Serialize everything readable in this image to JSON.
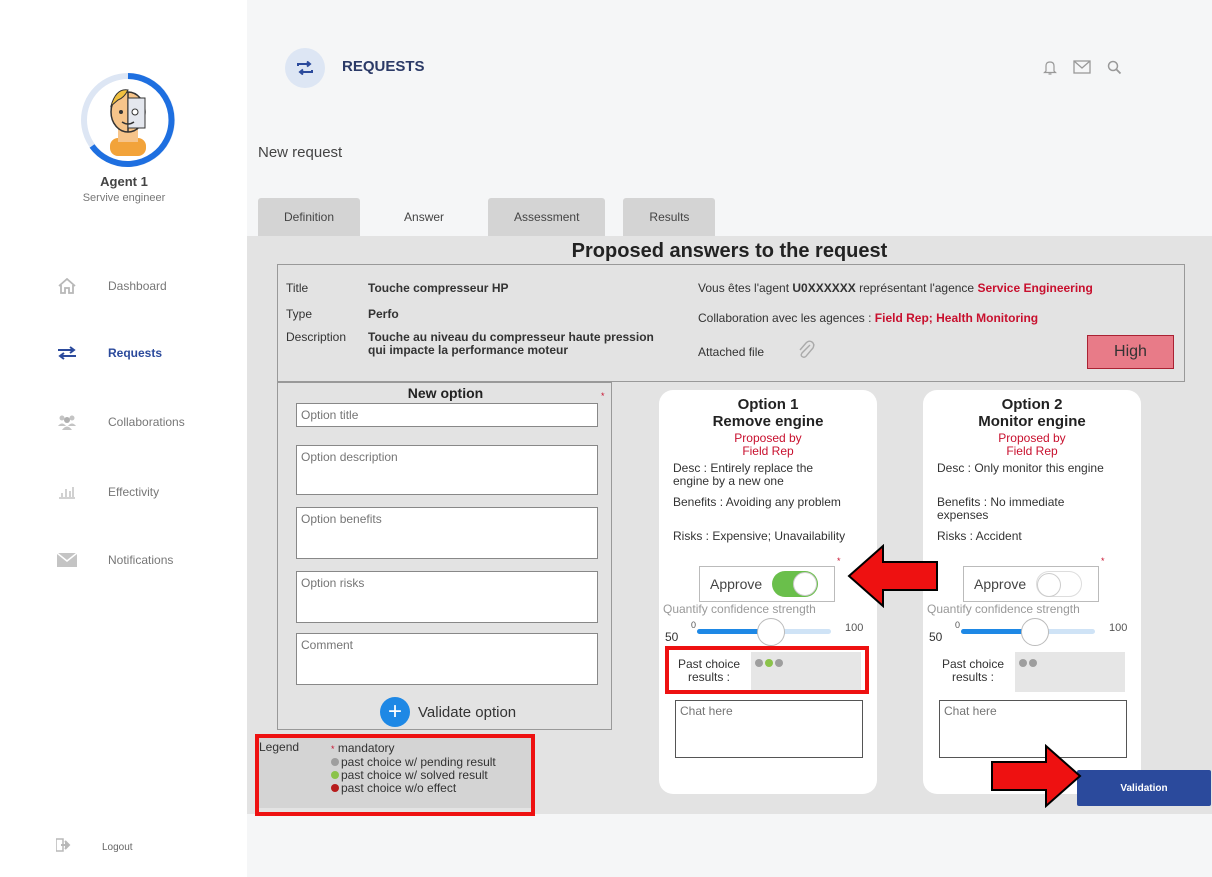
{
  "agent": {
    "name": "Agent 1",
    "role": "Servive engineer"
  },
  "nav": {
    "dashboard": "Dashboard",
    "requests": "Requests",
    "collaborations": "Collaborations",
    "effectivity": "Effectivity",
    "notifications": "Notifications",
    "logout": "Logout"
  },
  "header": {
    "title": "REQUESTS",
    "subtitle": "New request"
  },
  "tabs": [
    "Definition",
    "Answer",
    "Assessment",
    "Results"
  ],
  "active_tab": "Answer",
  "heading": "Proposed answers to the request",
  "request": {
    "title_label": "Title",
    "title_value": "Touche compresseur HP",
    "type_label": "Type",
    "type_value": "Perfo",
    "desc_label": "Description",
    "desc_line1": "Touche au niveau du compresseur haute pression",
    "desc_line2": "qui impacte la performance moteur",
    "agent_prefix": "Vous êtes l'agent ",
    "agent_id": "U0XXXXXX",
    "agent_mid": " représentant l'agence ",
    "agency": "Service Engineering",
    "collab_prefix": "Collaboration avec les agences : ",
    "collab_agencies": "Field Rep; Health Monitoring",
    "attached_label": "Attached file",
    "priority": "High"
  },
  "new_option": {
    "heading": "New option",
    "title_placeholder": "Option title",
    "description_placeholder": "Option description",
    "benefits_placeholder": "Option benefits",
    "risks_placeholder": "Option risks",
    "comment_placeholder": "Comment",
    "validate_label": "Validate option",
    "plus": "+"
  },
  "legend": {
    "title": "Legend",
    "mandatory": "mandatory",
    "pending": "past choice w/ pending result",
    "solved": "past choice w/ solved result",
    "no_effect": "past choice w/o effect",
    "colors": {
      "mandatory": "#c8102e",
      "pending": "#9e9e9e",
      "solved": "#8bc34a",
      "no_effect": "#b71c1c"
    }
  },
  "options": [
    {
      "title_line1": "Option 1",
      "title_line2": "Remove engine",
      "proposed_by_label": "Proposed by",
      "proposed_by": "Field Rep",
      "desc_line1": "Desc : Entirely replace the",
      "desc_line2": "engine by a new one",
      "benefits_line1": "Benefits : Avoiding any problem",
      "benefits_line2": "",
      "risks": "Risks : Expensive; Unavailability",
      "approve_label": "Approve",
      "approved": true,
      "confidence_label": "Quantify confidence strength",
      "confidence_value": "50",
      "slider_min": "0",
      "slider_max": "100",
      "past_label_line1": "Past choice",
      "past_label_line2": "results :",
      "past_dots": [
        "pending",
        "solved",
        "pending"
      ],
      "chat_placeholder": "Chat here"
    },
    {
      "title_line1": "Option 2",
      "title_line2": "Monitor engine",
      "proposed_by_label": "Proposed by",
      "proposed_by": "Field Rep",
      "desc_line1": "Desc : Only monitor this engine",
      "desc_line2": "",
      "benefits_line1": "Benefits : No immediate",
      "benefits_line2": "expenses",
      "risks": "Risks : Accident",
      "approve_label": "Approve",
      "approved": false,
      "confidence_label": "Quantify confidence strength",
      "confidence_value": "50",
      "slider_min": "0",
      "slider_max": "100",
      "past_label_line1": "Past choice",
      "past_label_line2": "results :",
      "past_dots": [
        "pending",
        "pending"
      ],
      "chat_placeholder": "Chat here"
    }
  ],
  "validation_label": "Validation",
  "colors": {
    "accent": "#2b4a9c",
    "toggle_on": "#6abf4b",
    "slider": "#1e88e5",
    "highlight": "#ee1111"
  }
}
